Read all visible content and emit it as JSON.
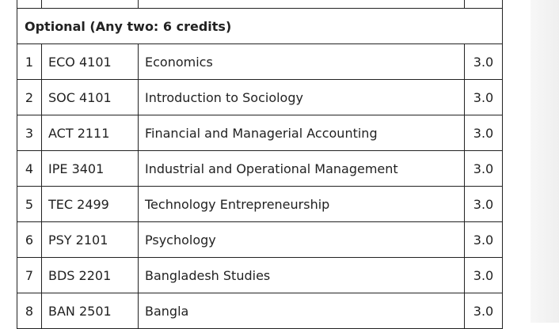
{
  "section": {
    "header": "Optional (Any two: 6 credits)"
  },
  "courses": [
    {
      "num": "1",
      "code": "ECO 4101",
      "title": "Economics",
      "credits": "3.0"
    },
    {
      "num": "2",
      "code": "SOC 4101",
      "title": "Introduction to Sociology",
      "credits": "3.0"
    },
    {
      "num": "3",
      "code": "ACT 2111",
      "title": "Financial and Managerial Accounting",
      "credits": "3.0"
    },
    {
      "num": "4",
      "code": "IPE 3401",
      "title": "Industrial and Operational Management",
      "credits": "3.0"
    },
    {
      "num": "5",
      "code": "TEC 2499",
      "title": "Technology Entrepreneurship",
      "credits": "3.0"
    },
    {
      "num": "6",
      "code": "PSY 2101",
      "title": "Psychology",
      "credits": "3.0"
    },
    {
      "num": "7",
      "code": "BDS 2201",
      "title": "Bangladesh Studies",
      "credits": "3.0"
    },
    {
      "num": "8",
      "code": "BAN 2501",
      "title": "Bangla",
      "credits": "3.0"
    }
  ]
}
